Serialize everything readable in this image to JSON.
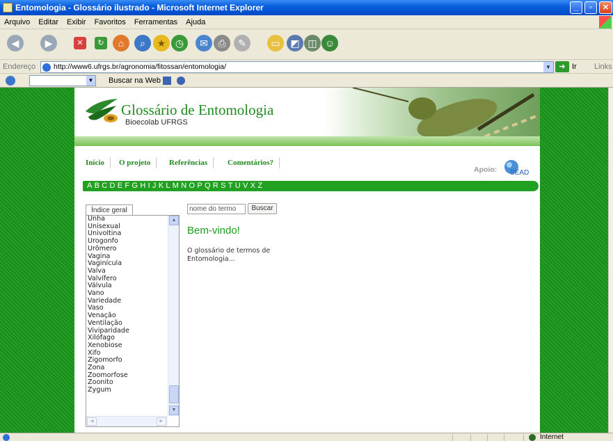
{
  "window": {
    "title": "Entomologia - Glossário ilustrado - Microsoft Internet Explorer"
  },
  "menu": [
    "Arquivo",
    "Editar",
    "Exibir",
    "Favoritos",
    "Ferramentas",
    "Ajuda"
  ],
  "address": {
    "label": "Endereço",
    "url": "http://www6.ufrgs.br/agronomia/fitossan/entomologia/",
    "go_label": "Ir",
    "links_label": "Links"
  },
  "search_toolbar": {
    "web_label": "Buscar na Web"
  },
  "site": {
    "title": "Glossário de Entomologia",
    "subtitle": "Bioecolab UFRGS",
    "nav": [
      "Início",
      "O projeto",
      "Referências",
      "Comentários?"
    ],
    "apoio_label": "Apoio:",
    "sponsor": "SEAD",
    "letters": [
      "A",
      "B",
      "C",
      "D",
      "E",
      "F",
      "G",
      "H",
      "I",
      "J",
      "K",
      "L",
      "M",
      "N",
      "O",
      "P",
      "Q",
      "R",
      "S",
      "T",
      "U",
      "V",
      "X",
      "Z"
    ],
    "index_tab": "Índice geral",
    "index_items": [
      "Unha",
      "Unisexual",
      "Univoltina",
      "Urogonfo",
      "Urômero",
      "Vagina",
      "Vaginícula",
      "Valva",
      "Valvífero",
      "Válvula",
      "Vano",
      "Variedade",
      "Vaso",
      "Venação",
      "Ventilação",
      "Viviparidade",
      "Xilófago",
      "Xenobiose",
      "Xifo",
      "Zigomorfo",
      "Zona",
      "Zoomorfose",
      "Zoonito",
      "Zygum"
    ],
    "search_placeholder": "nome do termo",
    "search_button": "Buscar",
    "welcome_heading": "Bem-vindo!",
    "welcome_text": "O glossário de termos de Entomologia..."
  },
  "status": {
    "zone": "Internet"
  }
}
